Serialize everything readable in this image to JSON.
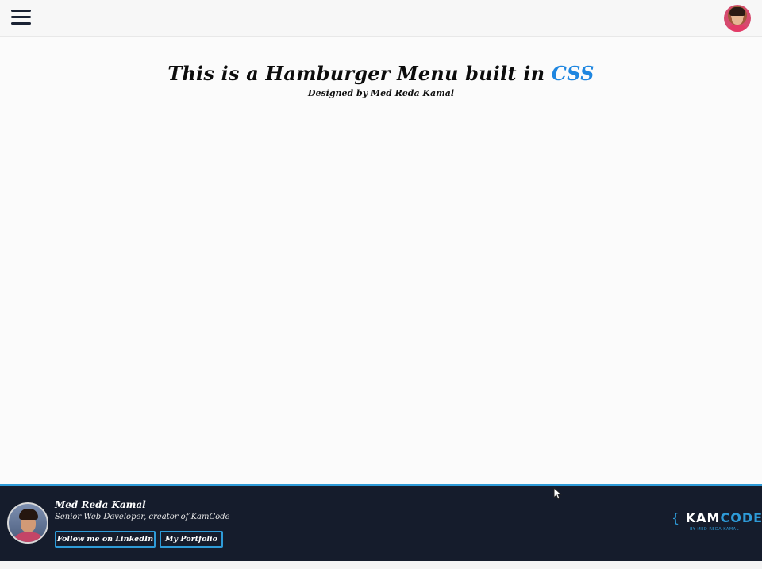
{
  "header": {
    "menu_icon": "hamburger-menu-icon",
    "avatar_icon": "profile-avatar"
  },
  "main": {
    "title_prefix": "This is a Hamburger Menu built in",
    "title_accent": "CSS",
    "subtitle": "Designed by Med Reda Kamal",
    "accent_color": "#1e86e0"
  },
  "footer": {
    "name": "Med Reda Kamal",
    "role": "Senior Web Developer, creator of KamCode",
    "buttons": {
      "linkedin": "Follow me on LinkedIn",
      "portfolio": "My Portfolio"
    },
    "logo": {
      "open_brace": "{",
      "kam": "KAM",
      "code": "CODE",
      "close_brace": "}",
      "byline": "BY MED REDA KAMAL"
    },
    "background_color": "#151c2c",
    "accent_color": "#2e9bd8"
  }
}
